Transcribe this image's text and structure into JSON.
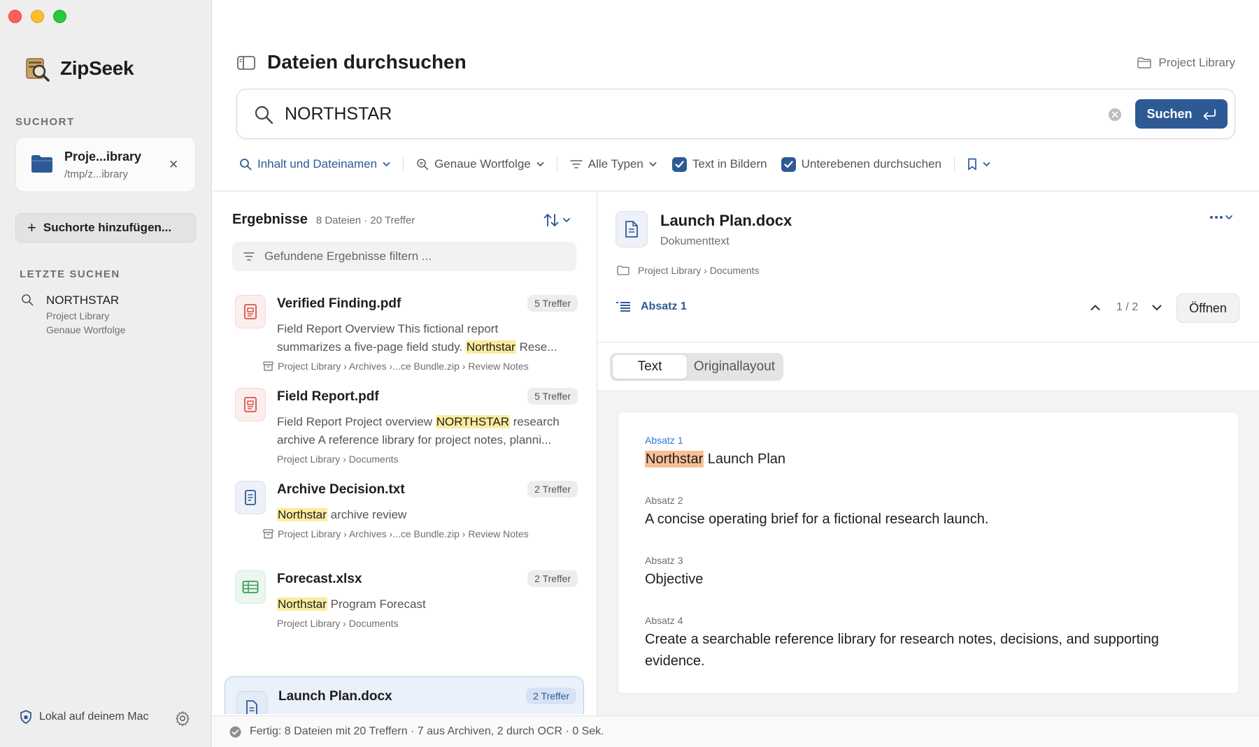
{
  "app": {
    "name": "ZipSeek"
  },
  "sidebar": {
    "search_location_title": "SUCHORT",
    "location": {
      "name": "Proje...ibrary",
      "path": "/tmp/z...ibrary"
    },
    "add_location_label": "Suchorte hinzufügen...",
    "recent_title": "LETZTE SUCHEN",
    "recent": [
      {
        "query": "NORTHSTAR",
        "scope": "Project Library",
        "mode": "Genaue Wortfolge"
      }
    ],
    "footer_label": "Lokal auf deinem Mac"
  },
  "header": {
    "title": "Dateien durchsuchen",
    "scope": "Project Library"
  },
  "search": {
    "value": "NORTHSTAR",
    "button_label": "Suchen"
  },
  "filters": {
    "scope_label": "Inhalt und Dateinamen",
    "match_label": "Genaue Wortfolge",
    "type_label": "Alle Typen",
    "ocr_label": "Text in Bildern",
    "ocr_checked": true,
    "subfolders_label": "Unterebenen durchsuchen",
    "subfolders_checked": true
  },
  "results": {
    "title": "Ergebnisse",
    "count": "8 Dateien · 20 Treffer",
    "filter_placeholder": "Gefundene Ergebnisse filtern ...",
    "items": [
      {
        "name": "Verified Finding.pdf",
        "badge": "5 Treffer",
        "snippet_line1": "Field Report Overview This fictional report",
        "snippet_pre": "summarizes a five-page field study. ",
        "snippet_hl": "Northstar",
        "snippet_post": " Rese...",
        "path": "Project Library › Archives ›...ce Bundle.zip › Review Notes"
      },
      {
        "name": "Field Report.pdf",
        "badge": "5 Treffer",
        "snippet_pre": "Field Report Project overview ",
        "snippet_hl": "NORTHSTAR",
        "snippet_post": " research",
        "snippet_line2": "archive A reference library for project notes, planni...",
        "path": "Project Library › Documents"
      },
      {
        "name": "Archive Decision.txt",
        "badge": "2 Treffer",
        "snippet_hl": "Northstar",
        "snippet_post": " archive review",
        "path": "Project Library › Archives ›...ce Bundle.zip › Review Notes"
      },
      {
        "name": "Forecast.xlsx",
        "badge": "2 Treffer",
        "snippet_hl": "Northstar",
        "snippet_post": " Program Forecast",
        "path": "Project Library › Documents"
      },
      {
        "name": "Launch Plan.docx",
        "badge": "2 Treffer"
      }
    ]
  },
  "preview": {
    "file_name": "Launch Plan.docx",
    "kind": "Dokumenttext",
    "path": "Project Library › Documents",
    "paragraph_label": "Absatz 1",
    "match_counter": "1 / 2",
    "open_label": "Öffnen",
    "tabs": [
      "Text",
      "Originallayout"
    ],
    "paragraphs": [
      {
        "label": "Absatz 1",
        "hl": "Northstar",
        "text": " Launch Plan"
      },
      {
        "label": "Absatz 2",
        "text": "A concise operating brief for a fictional research launch."
      },
      {
        "label": "Absatz 3",
        "text": "Objective"
      },
      {
        "label": "Absatz 4",
        "text": "Create a searchable reference library for research notes, decisions, and supporting evidence."
      }
    ]
  },
  "status": {
    "text": "Fertig: 8 Dateien mit 20 Treffern · 7 aus Archiven, 2 durch OCR · 0 Sek."
  },
  "colors": {
    "accent": "#2d5a95",
    "highlight": "#fbec9d",
    "active_highlight": "#f8bf94",
    "sidebar_bg": "#efeeee"
  }
}
